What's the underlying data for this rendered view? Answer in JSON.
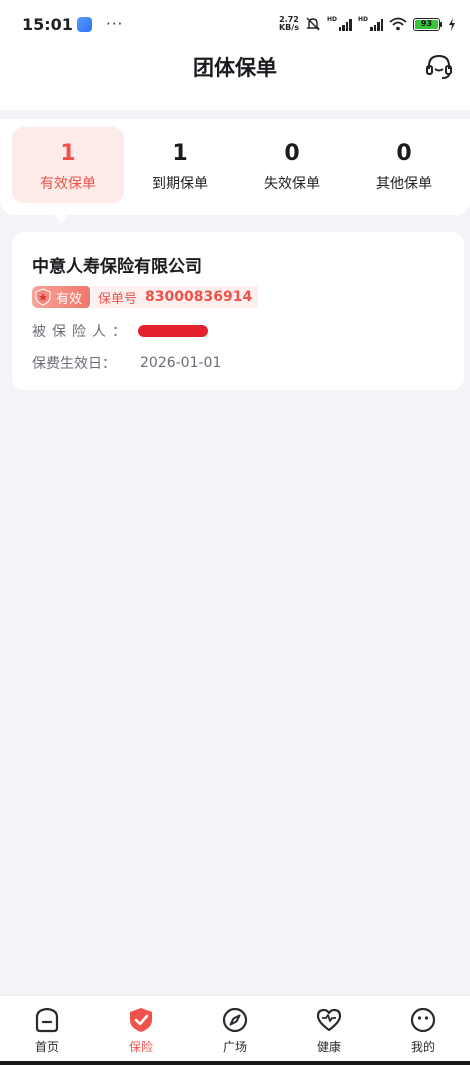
{
  "status_bar": {
    "time": "15:01",
    "more": "···",
    "net_speed_value": "2.72",
    "net_speed_unit": "KB/s",
    "hd1": "HD",
    "hd2": "HD",
    "battery": "93",
    "icons": [
      "app-notification-icon",
      "mute-icon",
      "signal-icon",
      "signal-icon",
      "wifi-icon",
      "battery-icon",
      "charging-icon"
    ]
  },
  "header": {
    "title": "团体保单",
    "service_icon": "customer-service-headset-icon"
  },
  "tabs": [
    {
      "count": "1",
      "label": "有效保单",
      "active": true
    },
    {
      "count": "1",
      "label": "到期保单",
      "active": false
    },
    {
      "count": "0",
      "label": "失效保单",
      "active": false
    },
    {
      "count": "0",
      "label": "其他保单",
      "active": false
    }
  ],
  "policy": {
    "company": "中意人寿保险有限公司",
    "status": "有效",
    "policy_no_label": "保单号",
    "policy_no": "83000836914",
    "insured_label": "被保险人：",
    "effective_label": "保费生效日：",
    "effective_date": "2026-01-01"
  },
  "bottom_nav": [
    {
      "label": "首页",
      "icon": "home-icon",
      "active": false
    },
    {
      "label": "保险",
      "icon": "insurance-shield-icon",
      "active": true
    },
    {
      "label": "广场",
      "icon": "compass-icon",
      "active": false
    },
    {
      "label": "健康",
      "icon": "heart-pulse-icon",
      "active": false
    },
    {
      "label": "我的",
      "icon": "smiley-profile-icon",
      "active": false
    }
  ],
  "colors": {
    "accent": "#f0524a",
    "active_tab_bg": "#fdebe9",
    "page_bg": "#f3f4f8"
  }
}
